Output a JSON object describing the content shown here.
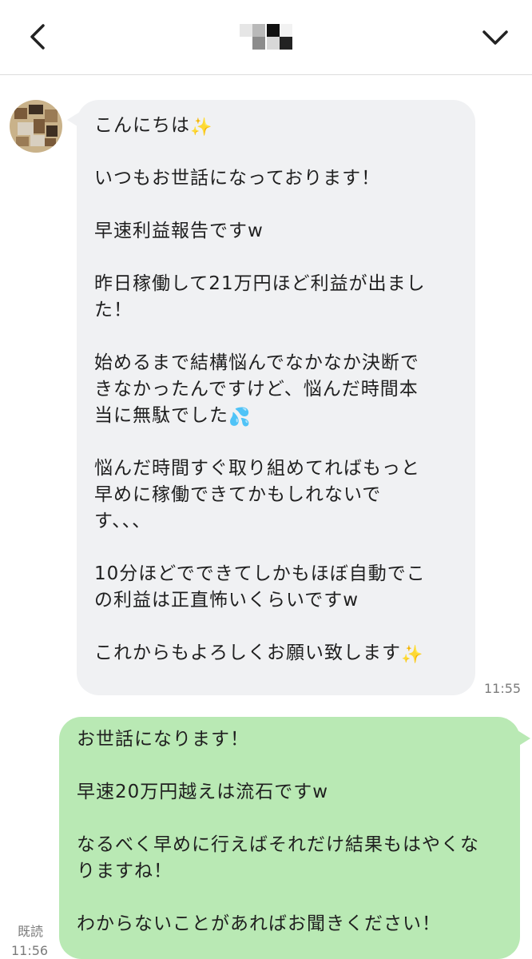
{
  "header": {
    "back_icon": "chevron-left-icon",
    "menu_icon": "chevron-down-icon",
    "title_mosaic_colors": [
      "#e6e6e6",
      "#b9b9b9",
      "#111111",
      "#d8d8d8",
      "#8c8c8c",
      "#f2f2f2",
      "#222222"
    ]
  },
  "incoming": {
    "avatar_colors": [
      "#7a5a3a",
      "#c9b28a",
      "#3e2f22",
      "#d8cfc0",
      "#9a7b55"
    ],
    "lines": [
      "こんにちは",
      "",
      "いつもお世話になっております！",
      "",
      "早速利益報告ですw",
      "",
      "昨日稼働して21万円ほど利益が出まし",
      "た！",
      "",
      "始めるまで結構悩んでなかなか決断で",
      "きなかったんですけど、悩んだ時間本",
      "当に無駄でした",
      "",
      "悩んだ時間すぐ取り組めてればもっと",
      "早めに稼働できてかもしれないで",
      "す、、、",
      "",
      "10分ほどでできてしかもほぼ自動でこ",
      "の利益は正直怖いくらいですw",
      "",
      "これからもよろしくお願い致します"
    ],
    "emoji": {
      "line_0": "✨",
      "line_11": "💦",
      "line_20": "✨"
    },
    "time": "11:55"
  },
  "outgoing": {
    "lines": [
      "お世話になります！",
      "",
      "早速20万円越えは流石ですw",
      "",
      "なるべく早めに行えばそれだけ結果もはやくな",
      "りますね！",
      "",
      "わからないことがあればお聞きください！"
    ],
    "read_label": "既読",
    "time": "11:56"
  }
}
